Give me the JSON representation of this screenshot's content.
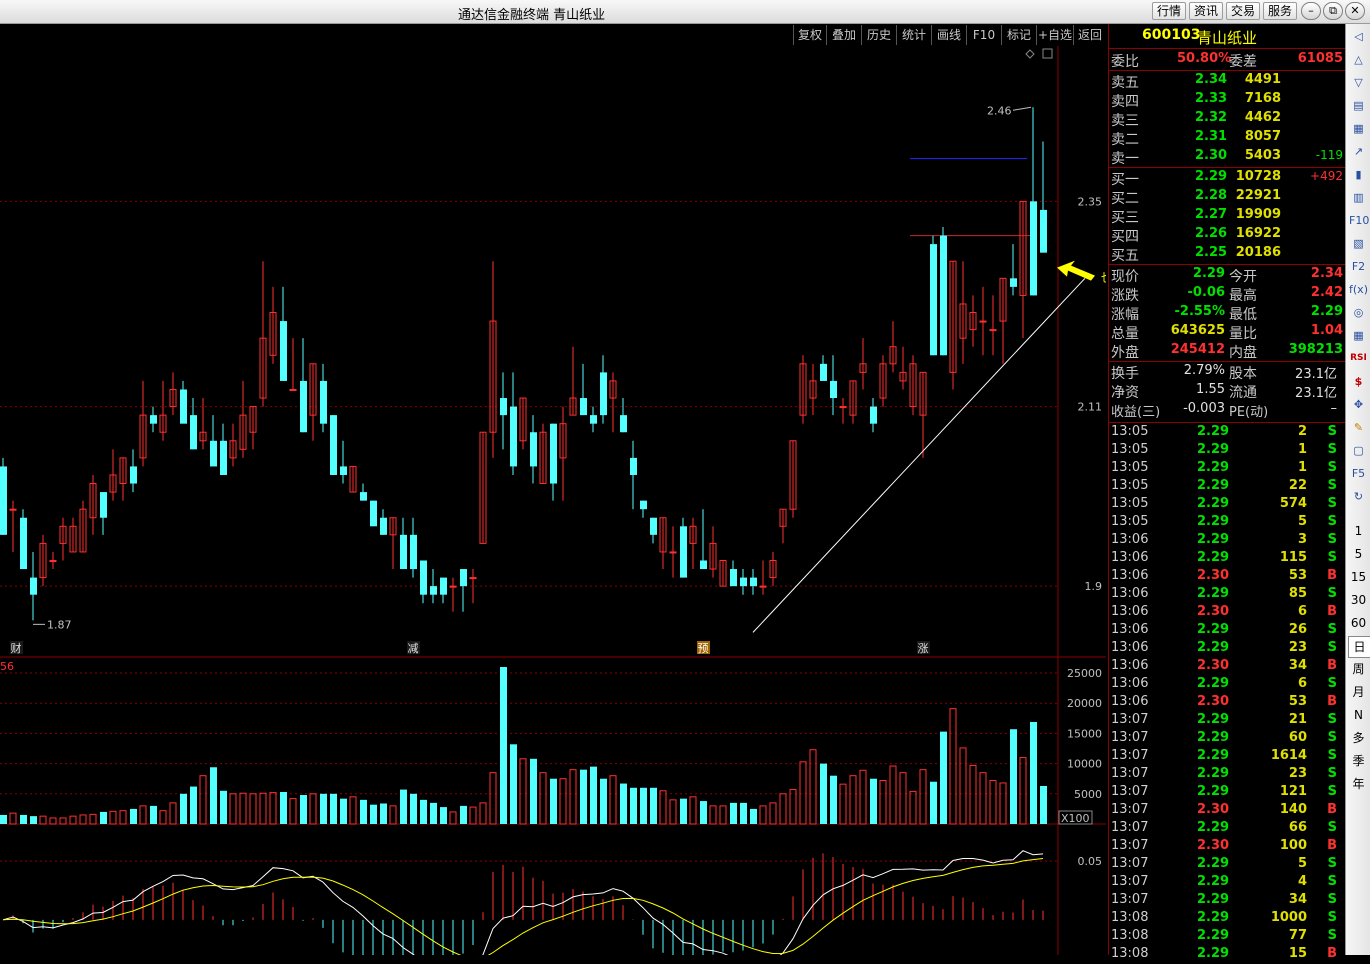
{
  "window": {
    "title": "通达信金融终端  青山纸业",
    "menus": [
      "行情",
      "资讯",
      "交易",
      "服务"
    ],
    "controls": {
      "minimize": "–",
      "restore": "⧉",
      "close": "✕"
    }
  },
  "toolbar": {
    "buttons": [
      "复权",
      "叠加",
      "历史",
      "统计",
      "画线",
      "F10",
      "标记",
      "+自选",
      "返回"
    ]
  },
  "chart": {
    "price_axis": {
      "min": 1.83,
      "max": 2.52,
      "ticks": [
        2.35,
        2.11,
        1.9
      ]
    },
    "candles": [
      {
        "o": 2.04,
        "h": 2.05,
        "l": 1.96,
        "c": 1.96
      },
      {
        "o": 1.99,
        "h": 2.0,
        "l": 1.94,
        "c": 1.99
      },
      {
        "o": 1.98,
        "h": 1.99,
        "l": 1.92,
        "c": 1.92
      },
      {
        "o": 1.91,
        "h": 1.94,
        "l": 1.86,
        "c": 1.89
      },
      {
        "o": 1.91,
        "h": 1.96,
        "l": 1.9,
        "c": 1.95
      },
      {
        "o": 1.93,
        "h": 1.94,
        "l": 1.92,
        "c": 1.93
      },
      {
        "o": 1.95,
        "h": 1.98,
        "l": 1.93,
        "c": 1.97
      },
      {
        "o": 1.94,
        "h": 1.98,
        "l": 1.94,
        "c": 1.97
      },
      {
        "o": 1.94,
        "h": 2.0,
        "l": 1.94,
        "c": 1.99
      },
      {
        "o": 1.98,
        "h": 2.03,
        "l": 1.96,
        "c": 2.02
      },
      {
        "o": 2.01,
        "h": 2.01,
        "l": 1.96,
        "c": 1.98
      },
      {
        "o": 2.01,
        "h": 2.06,
        "l": 2.0,
        "c": 2.03
      },
      {
        "o": 2.02,
        "h": 2.05,
        "l": 2.0,
        "c": 2.05
      },
      {
        "o": 2.04,
        "h": 2.06,
        "l": 2.01,
        "c": 2.02
      },
      {
        "o": 2.05,
        "h": 2.14,
        "l": 2.04,
        "c": 2.1
      },
      {
        "o": 2.1,
        "h": 2.11,
        "l": 2.08,
        "c": 2.09
      },
      {
        "o": 2.08,
        "h": 2.14,
        "l": 2.07,
        "c": 2.1
      },
      {
        "o": 2.11,
        "h": 2.15,
        "l": 2.1,
        "c": 2.13
      },
      {
        "o": 2.13,
        "h": 2.14,
        "l": 2.1,
        "c": 2.09
      },
      {
        "o": 2.1,
        "h": 2.12,
        "l": 2.06,
        "c": 2.06
      },
      {
        "o": 2.07,
        "h": 2.12,
        "l": 2.06,
        "c": 2.08
      },
      {
        "o": 2.07,
        "h": 2.1,
        "l": 2.04,
        "c": 2.04
      },
      {
        "o": 2.07,
        "h": 2.09,
        "l": 2.03,
        "c": 2.03
      },
      {
        "o": 2.05,
        "h": 2.09,
        "l": 2.04,
        "c": 2.07
      },
      {
        "o": 2.06,
        "h": 2.14,
        "l": 2.05,
        "c": 2.1
      },
      {
        "o": 2.08,
        "h": 2.11,
        "l": 2.06,
        "c": 2.11
      },
      {
        "o": 2.12,
        "h": 2.28,
        "l": 2.11,
        "c": 2.19
      },
      {
        "o": 2.17,
        "h": 2.25,
        "l": 2.16,
        "c": 2.22
      },
      {
        "o": 2.21,
        "h": 2.25,
        "l": 2.14,
        "c": 2.14
      },
      {
        "o": 2.13,
        "h": 2.19,
        "l": 2.13,
        "c": 2.13
      },
      {
        "o": 2.14,
        "h": 2.19,
        "l": 2.08,
        "c": 2.08
      },
      {
        "o": 2.1,
        "h": 2.16,
        "l": 2.07,
        "c": 2.16
      },
      {
        "o": 2.14,
        "h": 2.16,
        "l": 2.08,
        "c": 2.09
      },
      {
        "o": 2.1,
        "h": 2.1,
        "l": 2.03,
        "c": 2.03
      },
      {
        "o": 2.04,
        "h": 2.07,
        "l": 2.02,
        "c": 2.03
      },
      {
        "o": 2.01,
        "h": 2.04,
        "l": 2.01,
        "c": 2.04
      },
      {
        "o": 2.01,
        "h": 2.02,
        "l": 2.0,
        "c": 2.0
      },
      {
        "o": 2.0,
        "h": 2.0,
        "l": 1.97,
        "c": 1.97
      },
      {
        "o": 1.98,
        "h": 1.99,
        "l": 1.96,
        "c": 1.96
      },
      {
        "o": 1.96,
        "h": 1.98,
        "l": 1.92,
        "c": 1.98
      },
      {
        "o": 1.96,
        "h": 1.98,
        "l": 1.92,
        "c": 1.92
      },
      {
        "o": 1.96,
        "h": 1.98,
        "l": 1.91,
        "c": 1.92
      },
      {
        "o": 1.93,
        "h": 1.93,
        "l": 1.88,
        "c": 1.89
      },
      {
        "o": 1.9,
        "h": 1.92,
        "l": 1.88,
        "c": 1.89
      },
      {
        "o": 1.91,
        "h": 1.91,
        "l": 1.88,
        "c": 1.89
      },
      {
        "o": 1.9,
        "h": 1.91,
        "l": 1.87,
        "c": 1.9
      },
      {
        "o": 1.92,
        "h": 1.92,
        "l": 1.87,
        "c": 1.9
      },
      {
        "o": 1.91,
        "h": 1.92,
        "l": 1.88,
        "c": 1.91
      },
      {
        "o": 1.95,
        "h": 2.08,
        "l": 1.95,
        "c": 2.08
      },
      {
        "o": 2.08,
        "h": 2.28,
        "l": 2.05,
        "c": 2.21
      },
      {
        "o": 2.12,
        "h": 2.15,
        "l": 2.06,
        "c": 2.1
      },
      {
        "o": 2.11,
        "h": 2.15,
        "l": 2.03,
        "c": 2.04
      },
      {
        "o": 2.07,
        "h": 2.12,
        "l": 2.06,
        "c": 2.12
      },
      {
        "o": 2.08,
        "h": 2.1,
        "l": 2.02,
        "c": 2.04
      },
      {
        "o": 2.02,
        "h": 2.09,
        "l": 2.02,
        "c": 2.08
      },
      {
        "o": 2.09,
        "h": 2.09,
        "l": 2.0,
        "c": 2.02
      },
      {
        "o": 2.05,
        "h": 2.11,
        "l": 2.0,
        "c": 2.09
      },
      {
        "o": 2.1,
        "h": 2.18,
        "l": 2.1,
        "c": 2.12
      },
      {
        "o": 2.12,
        "h": 2.16,
        "l": 2.1,
        "c": 2.1
      },
      {
        "o": 2.1,
        "h": 2.11,
        "l": 2.08,
        "c": 2.09
      },
      {
        "o": 2.15,
        "h": 2.17,
        "l": 2.09,
        "c": 2.1
      },
      {
        "o": 2.12,
        "h": 2.15,
        "l": 2.08,
        "c": 2.14
      },
      {
        "o": 2.1,
        "h": 2.12,
        "l": 2.08,
        "c": 2.08
      },
      {
        "o": 2.05,
        "h": 2.07,
        "l": 1.99,
        "c": 2.03
      },
      {
        "o": 2.0,
        "h": 2.0,
        "l": 1.98,
        "c": 1.99
      },
      {
        "o": 1.98,
        "h": 1.98,
        "l": 1.95,
        "c": 1.96
      },
      {
        "o": 1.94,
        "h": 1.98,
        "l": 1.92,
        "c": 1.98
      },
      {
        "o": 1.94,
        "h": 1.97,
        "l": 1.91,
        "c": 1.94
      },
      {
        "o": 1.97,
        "h": 1.98,
        "l": 1.91,
        "c": 1.91
      },
      {
        "o": 1.95,
        "h": 1.98,
        "l": 1.92,
        "c": 1.97
      },
      {
        "o": 1.93,
        "h": 1.99,
        "l": 1.92,
        "c": 1.92
      },
      {
        "o": 1.92,
        "h": 1.97,
        "l": 1.91,
        "c": 1.95
      },
      {
        "o": 1.9,
        "h": 1.93,
        "l": 1.9,
        "c": 1.93
      },
      {
        "o": 1.92,
        "h": 1.93,
        "l": 1.9,
        "c": 1.9
      },
      {
        "o": 1.91,
        "h": 1.92,
        "l": 1.89,
        "c": 1.9
      },
      {
        "o": 1.91,
        "h": 1.92,
        "l": 1.89,
        "c": 1.9
      },
      {
        "o": 1.9,
        "h": 1.93,
        "l": 1.89,
        "c": 1.9
      },
      {
        "o": 1.91,
        "h": 1.94,
        "l": 1.9,
        "c": 1.93
      },
      {
        "o": 1.97,
        "h": 1.99,
        "l": 1.95,
        "c": 1.99
      },
      {
        "o": 1.99,
        "h": 2.07,
        "l": 1.98,
        "c": 2.07
      },
      {
        "o": 2.1,
        "h": 2.17,
        "l": 2.09,
        "c": 2.16
      },
      {
        "o": 2.12,
        "h": 2.16,
        "l": 2.1,
        "c": 2.14
      },
      {
        "o": 2.16,
        "h": 2.17,
        "l": 2.14,
        "c": 2.14
      },
      {
        "o": 2.14,
        "h": 2.17,
        "l": 2.1,
        "c": 2.12
      },
      {
        "o": 2.11,
        "h": 2.12,
        "l": 2.09,
        "c": 2.11
      },
      {
        "o": 2.1,
        "h": 2.14,
        "l": 2.09,
        "c": 2.14
      },
      {
        "o": 2.15,
        "h": 2.19,
        "l": 2.13,
        "c": 2.16
      },
      {
        "o": 2.11,
        "h": 2.12,
        "l": 2.08,
        "c": 2.09
      },
      {
        "o": 2.12,
        "h": 2.17,
        "l": 2.11,
        "c": 2.16
      },
      {
        "o": 2.16,
        "h": 2.21,
        "l": 2.15,
        "c": 2.18
      },
      {
        "o": 2.14,
        "h": 2.18,
        "l": 2.13,
        "c": 2.15
      },
      {
        "o": 2.11,
        "h": 2.17,
        "l": 2.1,
        "c": 2.16
      },
      {
        "o": 2.1,
        "h": 2.15,
        "l": 2.05,
        "c": 2.15
      },
      {
        "o": 2.3,
        "h": 2.31,
        "l": 2.17,
        "c": 2.17
      },
      {
        "o": 2.31,
        "h": 2.32,
        "l": 2.17,
        "c": 2.17
      },
      {
        "o": 2.15,
        "h": 2.28,
        "l": 2.13,
        "c": 2.28
      },
      {
        "o": 2.19,
        "h": 2.28,
        "l": 2.16,
        "c": 2.23
      },
      {
        "o": 2.2,
        "h": 2.24,
        "l": 2.18,
        "c": 2.22
      },
      {
        "o": 2.21,
        "h": 2.25,
        "l": 2.17,
        "c": 2.21
      },
      {
        "o": 2.2,
        "h": 2.24,
        "l": 2.17,
        "c": 2.2
      },
      {
        "o": 2.21,
        "h": 2.26,
        "l": 2.16,
        "c": 2.26
      },
      {
        "o": 2.26,
        "h": 2.3,
        "l": 2.24,
        "c": 2.25
      },
      {
        "o": 2.24,
        "h": 2.35,
        "l": 2.19,
        "c": 2.35
      },
      {
        "o": 2.35,
        "h": 2.46,
        "l": 2.24,
        "c": 2.24
      },
      {
        "o": 2.34,
        "h": 2.42,
        "l": 2.29,
        "c": 2.29
      }
    ],
    "support_line": {
      "start": {
        "index": 75,
        "price": 1.86
      },
      "end": {
        "index": 106,
        "price": 2.26
      }
    },
    "hlines": [
      {
        "price": 2.4,
        "from": 91,
        "to": 102,
        "color": "#2828ff"
      },
      {
        "price": 2.31,
        "from": 91,
        "to": 103,
        "color": "#c82828"
      }
    ],
    "annotations": {
      "high_label": "2.46",
      "low_label": "1.87",
      "arrow_text": "也快击穿止损了"
    },
    "event_markers": [
      {
        "index": 1,
        "text": "财"
      },
      {
        "index": 41,
        "text": "减"
      },
      {
        "index": 70,
        "text": "预"
      },
      {
        "index": 92,
        "text": "涨"
      }
    ],
    "volume": {
      "label": "56",
      "unit_label": "X100",
      "ticks": [
        25000,
        20000,
        15000,
        10000,
        5000
      ],
      "values": [
        1500,
        1800,
        1500,
        1300,
        1300,
        1000,
        1000,
        1300,
        1500,
        1600,
        2000,
        2100,
        2200,
        2500,
        3000,
        3000,
        2200,
        3500,
        5000,
        6200,
        8000,
        9400,
        5500,
        5000,
        5100,
        5000,
        5100,
        5200,
        5300,
        4200,
        4800,
        5000,
        5000,
        5000,
        4200,
        4500,
        4000,
        3200,
        3400,
        3000,
        5700,
        5000,
        4000,
        3500,
        2800,
        2000,
        3000,
        2800,
        3500,
        8500,
        26000,
        13200,
        10800,
        10800,
        8500,
        7500,
        7500,
        9000,
        9000,
        9500,
        7500,
        8000,
        6700,
        6000,
        6000,
        6000,
        5500,
        4000,
        4200,
        4500,
        3800,
        3000,
        3000,
        3500,
        3500,
        2500,
        3000,
        3500,
        5000,
        5700,
        10300,
        12300,
        10000,
        8000,
        6600,
        8000,
        8900,
        7500,
        7200,
        9600,
        8500,
        5400,
        9000,
        7000,
        15300,
        19100,
        12600,
        9700,
        8500,
        7200,
        6800,
        15700,
        11000,
        16900,
        6300
      ]
    },
    "macd": {
      "tick_label": "0.05",
      "zero_level": 0.0,
      "scale_max": 0.08,
      "scale_min": -0.03
    }
  },
  "quote": {
    "code": "600103",
    "name": "青山纸业",
    "weibi": {
      "label": "委比",
      "value": "50.80%",
      "diff_label": "委差",
      "diff_value": "61085"
    },
    "asks": [
      {
        "label": "卖五",
        "price": "2.34",
        "vol": "4491",
        "chg": ""
      },
      {
        "label": "卖四",
        "price": "2.33",
        "vol": "7168",
        "chg": ""
      },
      {
        "label": "卖三",
        "price": "2.32",
        "vol": "4462",
        "chg": ""
      },
      {
        "label": "卖二",
        "price": "2.31",
        "vol": "8057",
        "chg": ""
      },
      {
        "label": "卖一",
        "price": "2.30",
        "vol": "5403",
        "chg": "-119"
      }
    ],
    "bids": [
      {
        "label": "买一",
        "price": "2.29",
        "vol": "10728",
        "chg": "+492"
      },
      {
        "label": "买二",
        "price": "2.28",
        "vol": "22921",
        "chg": ""
      },
      {
        "label": "买三",
        "price": "2.27",
        "vol": "19909",
        "chg": ""
      },
      {
        "label": "买四",
        "price": "2.26",
        "vol": "16922",
        "chg": ""
      },
      {
        "label": "买五",
        "price": "2.25",
        "vol": "20186",
        "chg": ""
      }
    ],
    "stats": [
      {
        "l1": "现价",
        "v1": "2.29",
        "c1": "#00e000",
        "l2": "今开",
        "v2": "2.34",
        "c2": "#ff3030"
      },
      {
        "l1": "涨跌",
        "v1": "-0.06",
        "c1": "#00e000",
        "l2": "最高",
        "v2": "2.42",
        "c2": "#ff3030"
      },
      {
        "l1": "涨幅",
        "v1": "-2.55%",
        "c1": "#00e000",
        "l2": "最低",
        "v2": "2.29",
        "c2": "#00e000"
      },
      {
        "l1": "总量",
        "v1": "643625",
        "c1": "#e0e000",
        "l2": "量比",
        "v2": "1.04",
        "c2": "#ff3030"
      },
      {
        "l1": "外盘",
        "v1": "245412",
        "c1": "#ff3030",
        "l2": "内盘",
        "v2": "398213",
        "c2": "#00e000"
      }
    ],
    "finance": [
      {
        "l1": "换手",
        "v1": "2.79%",
        "l2": "股本",
        "v2": "23.1亿"
      },
      {
        "l1": "净资",
        "v1": "1.55",
        "l2": "流通",
        "v2": "23.1亿"
      },
      {
        "l1": "收益(三)",
        "v1": "-0.003",
        "l2": "PE(动)",
        "v2": "–"
      }
    ]
  },
  "ticks": [
    {
      "t": "13:05",
      "p": "2.29",
      "v": "2",
      "s": "S"
    },
    {
      "t": "13:05",
      "p": "2.29",
      "v": "1",
      "s": "S"
    },
    {
      "t": "13:05",
      "p": "2.29",
      "v": "1",
      "s": "S"
    },
    {
      "t": "13:05",
      "p": "2.29",
      "v": "22",
      "s": "S"
    },
    {
      "t": "13:05",
      "p": "2.29",
      "v": "574",
      "s": "S"
    },
    {
      "t": "13:05",
      "p": "2.29",
      "v": "5",
      "s": "S"
    },
    {
      "t": "13:06",
      "p": "2.29",
      "v": "3",
      "s": "S"
    },
    {
      "t": "13:06",
      "p": "2.29",
      "v": "115",
      "s": "S"
    },
    {
      "t": "13:06",
      "p": "2.30",
      "v": "53",
      "s": "B"
    },
    {
      "t": "13:06",
      "p": "2.29",
      "v": "85",
      "s": "S"
    },
    {
      "t": "13:06",
      "p": "2.30",
      "v": "6",
      "s": "B"
    },
    {
      "t": "13:06",
      "p": "2.29",
      "v": "26",
      "s": "S"
    },
    {
      "t": "13:06",
      "p": "2.29",
      "v": "23",
      "s": "S"
    },
    {
      "t": "13:06",
      "p": "2.30",
      "v": "34",
      "s": "B"
    },
    {
      "t": "13:06",
      "p": "2.29",
      "v": "6",
      "s": "S"
    },
    {
      "t": "13:06",
      "p": "2.30",
      "v": "53",
      "s": "B"
    },
    {
      "t": "13:07",
      "p": "2.29",
      "v": "21",
      "s": "S"
    },
    {
      "t": "13:07",
      "p": "2.29",
      "v": "60",
      "s": "S"
    },
    {
      "t": "13:07",
      "p": "2.29",
      "v": "1614",
      "s": "S"
    },
    {
      "t": "13:07",
      "p": "2.29",
      "v": "23",
      "s": "S"
    },
    {
      "t": "13:07",
      "p": "2.29",
      "v": "121",
      "s": "S"
    },
    {
      "t": "13:07",
      "p": "2.30",
      "v": "140",
      "s": "B"
    },
    {
      "t": "13:07",
      "p": "2.29",
      "v": "66",
      "s": "S"
    },
    {
      "t": "13:07",
      "p": "2.30",
      "v": "100",
      "s": "B"
    },
    {
      "t": "13:07",
      "p": "2.29",
      "v": "5",
      "s": "S"
    },
    {
      "t": "13:07",
      "p": "2.29",
      "v": "4",
      "s": "S"
    },
    {
      "t": "13:07",
      "p": "2.29",
      "v": "34",
      "s": "S"
    },
    {
      "t": "13:08",
      "p": "2.29",
      "v": "1000",
      "s": "S"
    },
    {
      "t": "13:08",
      "p": "2.29",
      "v": "77",
      "s": "S"
    },
    {
      "t": "13:08",
      "p": "2.29",
      "v": "15",
      "s": "B"
    }
  ],
  "sidebar": {
    "tools": [
      "◁",
      "△",
      "▽",
      "▤",
      "▦",
      "↗",
      "▮",
      "▥",
      "F10",
      "▧",
      "F2",
      "f(x)",
      "◎",
      "▦",
      "RSI",
      "$",
      "✥",
      "✎",
      "▢",
      "F5",
      "↻"
    ],
    "periods": [
      "1",
      "5",
      "15",
      "30",
      "60",
      "日",
      "周",
      "月",
      "N",
      "多",
      "季",
      "年"
    ]
  },
  "colors": {
    "up": "#ff3030",
    "down": "#54ffff",
    "grid": "#8b0000",
    "axis_text": "#c0c0c0"
  }
}
